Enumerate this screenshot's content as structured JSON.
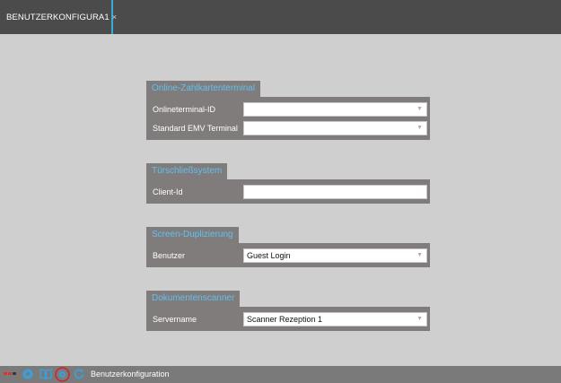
{
  "tabs": [
    {
      "label": "BENUTZERKONFIGURA1",
      "close": "×"
    }
  ],
  "sections": [
    {
      "title": "Online-Zahlkartenterminal",
      "fields": [
        {
          "label": "Onlineterminal-ID",
          "value": "",
          "type": "select"
        },
        {
          "label": "Standard EMV Terminal",
          "value": "",
          "type": "select"
        }
      ]
    },
    {
      "title": "Türschließsystem",
      "fields": [
        {
          "label": "Client-Id",
          "value": "",
          "type": "text"
        }
      ]
    },
    {
      "title": "Screen-Duplizierung",
      "fields": [
        {
          "label": "Benutzer",
          "value": "Guest Login",
          "type": "select"
        }
      ]
    },
    {
      "title": "Dokumentenscanner",
      "fields": [
        {
          "label": "Servername",
          "value": "Scanner Rezeption 1",
          "type": "select"
        }
      ]
    }
  ],
  "statusbar": {
    "label": "Benutzerkonfiguration",
    "icons": [
      "status-dots-icon",
      "gear-cog-icon",
      "book-icon",
      "settings-icon",
      "refresh-icon"
    ]
  },
  "colors": {
    "accent": "#39a9e0",
    "section_title": "#5fc1f2",
    "panel": "#807c7c",
    "highlight_ring": "#d0202a"
  }
}
